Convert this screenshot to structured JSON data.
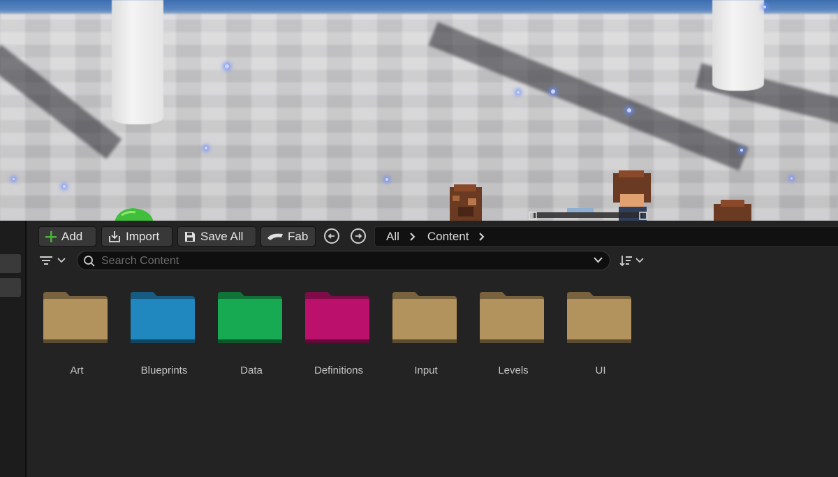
{
  "toolbar": {
    "add_label": "Add",
    "import_label": "Import",
    "save_all_label": "Save All",
    "fab_label": "Fab"
  },
  "breadcrumb": [
    "All",
    "Content"
  ],
  "search": {
    "placeholder": "Search Content",
    "value": ""
  },
  "folders": [
    {
      "name": "Art",
      "color": "#a88a58"
    },
    {
      "name": "Blueprints",
      "color": "#1f7fb4"
    },
    {
      "name": "Data",
      "color": "#16a04e"
    },
    {
      "name": "Definitions",
      "color": "#b01066"
    },
    {
      "name": "Input",
      "color": "#a88a58"
    },
    {
      "name": "Levels",
      "color": "#a88a58"
    },
    {
      "name": "UI",
      "color": "#a88a58"
    }
  ],
  "colors": {
    "accent_add": "#4caf3c",
    "panel_bg": "#232323",
    "button_bg": "#383838"
  },
  "icons": [
    "plus-icon",
    "import-icon",
    "save-icon",
    "fab-icon",
    "back-icon",
    "forward-icon",
    "chevron-right-icon",
    "filter-icon",
    "chevron-down-icon",
    "search-icon",
    "sort-icon",
    "folder-icon"
  ]
}
